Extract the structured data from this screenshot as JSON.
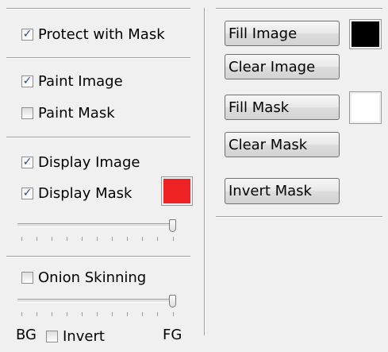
{
  "left_panel": {
    "protect_with_mask": {
      "label": "Protect with Mask",
      "checked": true
    },
    "paint_image": {
      "label": "Paint Image",
      "checked": true
    },
    "paint_mask": {
      "label": "Paint Mask",
      "checked": false
    },
    "display_image": {
      "label": "Display Image",
      "checked": true
    },
    "display_mask": {
      "label": "Display Mask",
      "checked": true
    },
    "mask_color": "#ee2222",
    "mask_opacity_slider": {
      "value": 1.0
    },
    "onion_skinning": {
      "label": "Onion Skinning",
      "checked": false
    },
    "onion_slider": {
      "value": 1.0
    },
    "bg_label": "BG",
    "invert": {
      "label": "Invert",
      "checked": false
    },
    "fg_label": "FG"
  },
  "right_panel": {
    "fill_image_label": "Fill Image",
    "fill_image_color": "#000000",
    "clear_image_label": "Clear Image",
    "fill_mask_label": "Fill Mask",
    "fill_mask_color": "#ffffff",
    "clear_mask_label": "Clear Mask",
    "invert_mask_label": "Invert Mask"
  }
}
